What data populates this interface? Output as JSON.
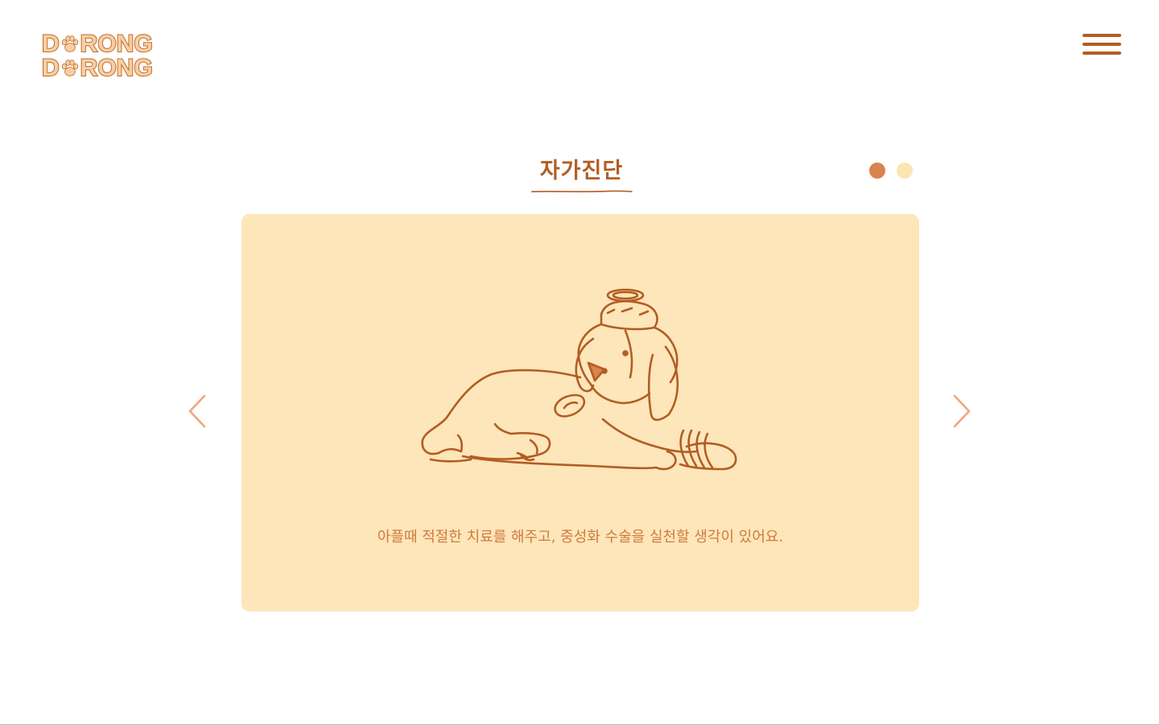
{
  "logo": {
    "line1": [
      "D",
      "RONG"
    ],
    "line2": [
      "D",
      "RONG"
    ],
    "accent_color": "#c86a2c",
    "fill_color": "#f3d0a4"
  },
  "header": {
    "menu_icon": "hamburger-icon",
    "menu_color": "#b35d23"
  },
  "section": {
    "title": "자가진단",
    "title_color": "#b35d23"
  },
  "pagination": {
    "count": 2,
    "active_index": 0,
    "active_color": "#d9834e",
    "inactive_color": "#fde4b3"
  },
  "slide": {
    "background": "#fde6ba",
    "text": "아플때 적절한 치료를 해주고, 중성화 수술을 실천할 생각이 있어요.",
    "text_color": "#d07a3e",
    "illustration": "sick-dog-illustration"
  },
  "navigation": {
    "prev_icon": "chevron-left-icon",
    "next_icon": "chevron-right-icon",
    "arrow_color": "#f2a57a"
  }
}
